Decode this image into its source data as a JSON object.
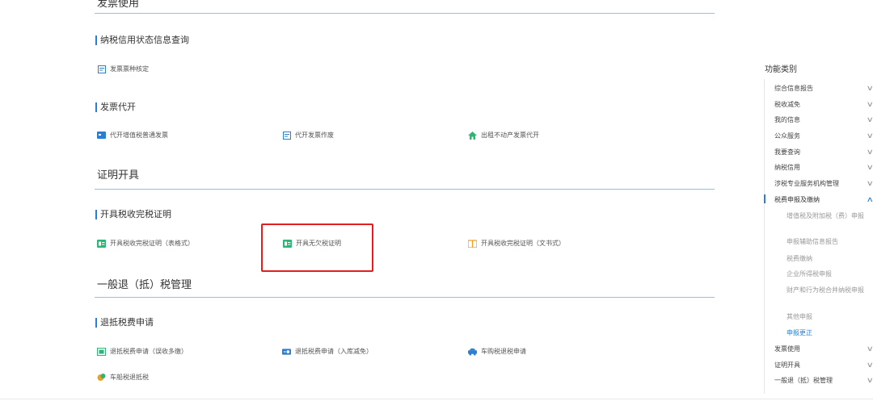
{
  "main": {
    "cut_title": "发票使用",
    "credit_subheading": "纳税信用状态信息查询",
    "credit_item": "发票票种核定",
    "invoice_subheading": "发票代开",
    "invoice_items": [
      "代开增值税普通发票",
      "代开发票作废",
      "出租不动产发票代开"
    ],
    "cert_section": "证明开具",
    "cert_subheading": "开具税收完税证明",
    "cert_items": [
      "开具税收完税证明（表格式）",
      "开具无欠税证明",
      "开具税收完税证明（文书式）"
    ],
    "refund_section": "一般退（抵）税管理",
    "refund_subheading": "退抵税费申请",
    "refund_items": [
      "退抵税费申请（误收多缴）",
      "退抵税费申请（入库减免）",
      "车购税退税申请",
      "车船税退抵税"
    ]
  },
  "sidebar": {
    "title": "功能类别",
    "items": [
      "综合信息报告",
      "税收减免",
      "我的信息",
      "公众服务",
      "我要查询",
      "纳税信用",
      "涉税专业服务机构管理",
      "税费申报及缴纳"
    ],
    "subitems": [
      "增值税及附加税（费）申报",
      "申报辅助信息报告",
      "税费缴纳",
      "企业所得税申报",
      "财产和行为税合并纳税申报",
      "其他申报",
      "申报更正"
    ],
    "bottom_items": [
      "发票使用",
      "证明开具",
      "一般退（抵）税管理"
    ]
  },
  "colors": {
    "accent": "#2a7fd4",
    "highlight_box": "#e02020",
    "divider": "#8cc4e6"
  }
}
